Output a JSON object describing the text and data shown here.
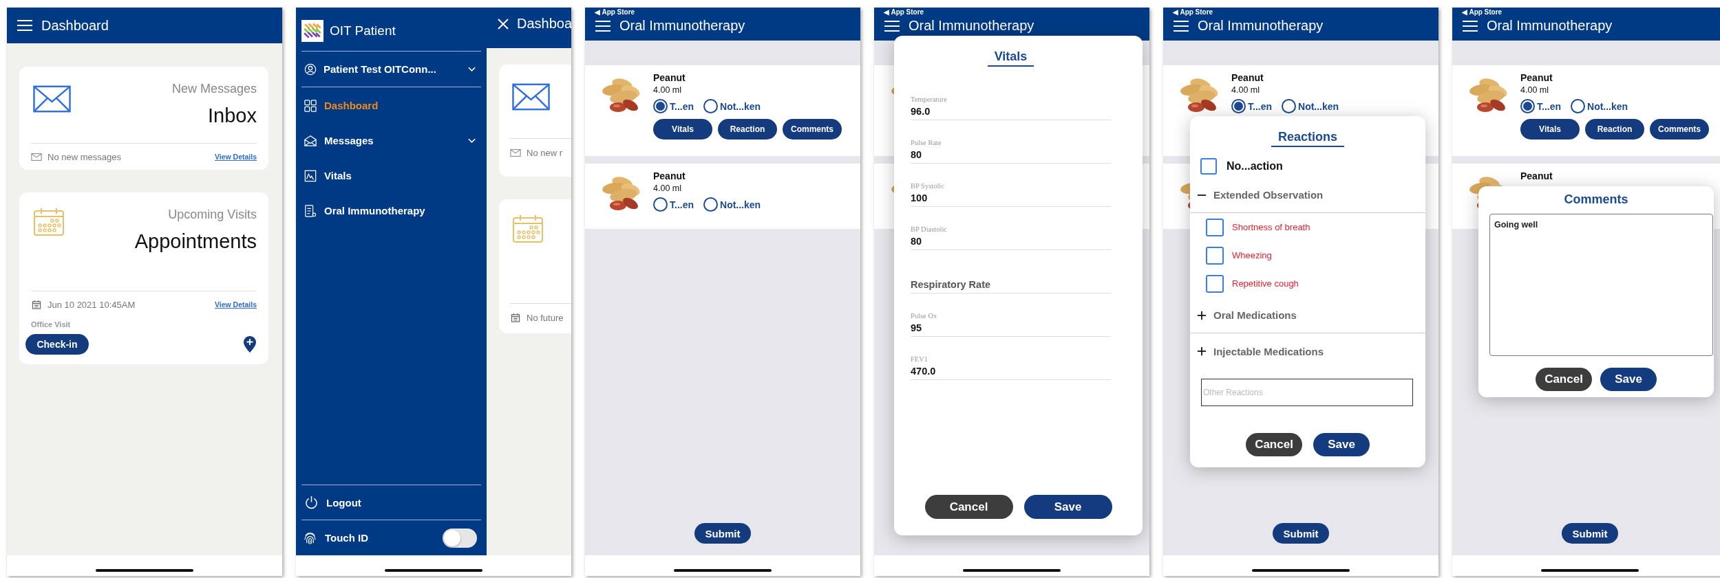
{
  "screens": [
    {
      "kind": "dashboard",
      "header": {
        "title": "Dashboard"
      },
      "cards": [
        {
          "kind": "messages",
          "subtitle": "New Messages",
          "title": "Inbox",
          "footer_text": "No new messages",
          "link": "View Details"
        },
        {
          "kind": "appointments",
          "subtitle": "Upcoming Visits",
          "title": "Appointments",
          "footer_text": "Jun 10 2021 10:45AM",
          "link": "View Details",
          "visit_type": "Office Visit",
          "button": "Check-in"
        }
      ]
    },
    {
      "kind": "menu",
      "drawer": {
        "app_name": "OIT Patient",
        "user": "Patient Test OITConn...",
        "items": [
          {
            "kind": "link",
            "label": "Dashboard",
            "selected": true
          },
          {
            "kind": "group",
            "label": "Messages",
            "selected": false,
            "expanded": false
          },
          {
            "kind": "link",
            "label": "Vitals",
            "selected": false
          },
          {
            "kind": "link",
            "label": "Oral Immunotherapy",
            "selected": false
          }
        ],
        "logout": "Logout",
        "touch_id": {
          "label": "Touch ID",
          "on": false
        }
      },
      "behind": {
        "title": "Dashboa",
        "cards": [
          {
            "kind": "messages",
            "footer_text": "No new r"
          },
          {
            "kind": "appointments",
            "footer_text": "No future"
          }
        ]
      }
    },
    {
      "kind": "medications",
      "status": "◀ App Store",
      "header": {
        "title": "Oral Immunotherapy"
      },
      "doses": [
        {
          "kind": "dose",
          "name": "Peanut",
          "amount": "4.00 ml",
          "options": [
            {
              "label": "T...en",
              "selected": true
            },
            {
              "label": "Not...ken",
              "selected": false
            }
          ],
          "buttons": [
            "Vitals",
            "Reaction",
            "Comments"
          ]
        },
        {
          "kind": "dose",
          "name": "Peanut",
          "amount": "4.00 ml",
          "options": [
            {
              "label": "T...en",
              "selected": false
            },
            {
              "label": "Not...ken",
              "selected": false
            }
          ]
        }
      ],
      "submit": "Submit"
    },
    {
      "kind": "medications",
      "status": "◀ App Store",
      "header": {
        "title": "Oral Immunotherapy"
      },
      "doses": [
        {
          "kind": "dose"
        },
        {
          "kind": "dose"
        }
      ],
      "dialog": {
        "kind": "vitals",
        "title": "Vitals",
        "fields": [
          {
            "label": "Temperature",
            "value": "96.0"
          },
          {
            "label": "Pulse Rate",
            "value": "80"
          },
          {
            "label": "BP Systolic",
            "value": "100"
          },
          {
            "label": "BP Diastolic",
            "value": "80"
          },
          {
            "placeholder": "Respiratory Rate"
          },
          {
            "label": "Pulse Ox",
            "value": "95"
          },
          {
            "label": "FEV1",
            "value": "470.0"
          }
        ],
        "buttons": [
          {
            "kind": "cancel",
            "label": "Cancel"
          },
          {
            "kind": "save",
            "label": "Save"
          }
        ]
      }
    },
    {
      "kind": "medications",
      "status": "◀ App Store",
      "header": {
        "title": "Oral Immunotherapy"
      },
      "doses": [
        {
          "kind": "dose",
          "name": "Peanut",
          "amount": "4.00 ml",
          "options": [
            {
              "label": "T...en",
              "selected": true
            },
            {
              "label": "Not...ken",
              "selected": false
            }
          ]
        },
        {
          "kind": "dose"
        }
      ],
      "submit": "Submit",
      "dialog": {
        "kind": "reactions",
        "title": "Reactions",
        "none_option": {
          "label": "No...action",
          "checked": false
        },
        "sections": [
          {
            "label": "Extended Observation",
            "expanded": true,
            "items": [
              {
                "label": "Shortness of breath",
                "checked": false
              },
              {
                "label": "Wheezing",
                "checked": false
              },
              {
                "label": "Repetitive cough",
                "checked": false
              }
            ]
          },
          {
            "label": "Oral Medications",
            "expanded": false
          },
          {
            "label": "Injectable Medications",
            "expanded": false
          }
        ],
        "other": {
          "placeholder": "Other Reactions"
        },
        "buttons": [
          {
            "kind": "cancel",
            "label": "Cancel"
          },
          {
            "kind": "save",
            "label": "Save"
          }
        ]
      }
    },
    {
      "kind": "medications",
      "status": "◀ App Store",
      "header": {
        "title": "Oral Immunotherapy"
      },
      "doses": [
        {
          "kind": "dose",
          "name": "Peanut",
          "amount": "4.00 ml",
          "options": [
            {
              "label": "T...en",
              "selected": true
            },
            {
              "label": "Not...ken",
              "selected": false
            }
          ],
          "buttons": [
            "Vitals",
            "Reaction",
            "Comments"
          ]
        },
        {
          "kind": "dose",
          "name": "Peanut"
        }
      ],
      "submit": "Submit",
      "dialog": {
        "kind": "comments",
        "title": "Comments",
        "value": "Going well",
        "buttons": [
          {
            "kind": "cancel",
            "label": "Cancel"
          },
          {
            "kind": "save",
            "label": "Save"
          }
        ]
      }
    }
  ]
}
